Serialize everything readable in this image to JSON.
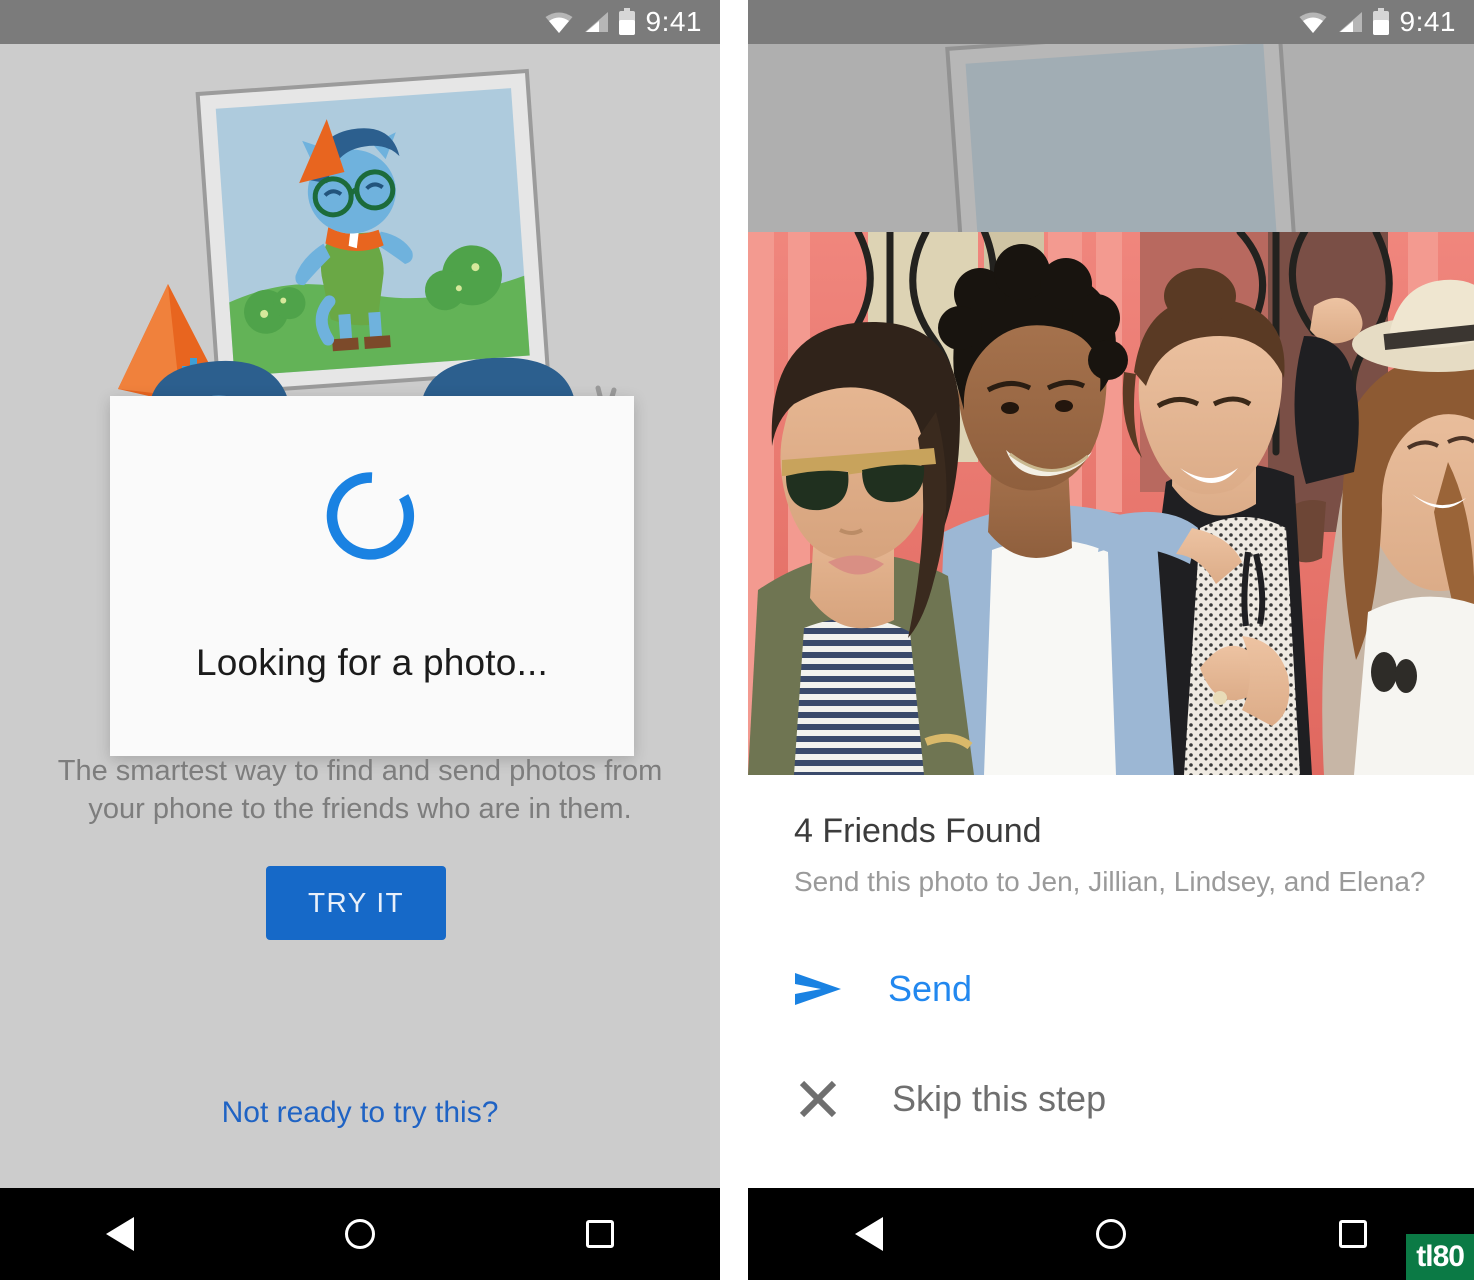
{
  "colors": {
    "accent_blue": "#1669c8",
    "link_blue": "#1f63c4",
    "send_blue": "#2288ef",
    "spinner_blue": "#1a82e2",
    "panel_bg": "#cccccc",
    "statusbar_bg": "#7b7b7b",
    "navbar_bg": "#000000",
    "dialog_bg": "#fafafa",
    "muted_text": "#7d7d7d",
    "watermark_green": "#0b7a45"
  },
  "statusbar": {
    "time": "9:41",
    "icons": [
      "wifi-icon",
      "cellular-signal-icon",
      "battery-icon"
    ]
  },
  "navbar": {
    "back_label": "Back",
    "home_label": "Home",
    "recents_label": "Recent apps",
    "icons": [
      "nav-back-icon",
      "nav-home-icon",
      "nav-recents-icon"
    ]
  },
  "left_screen": {
    "illustration_name": "photo-frame-characters-illustration",
    "dialog": {
      "spinner_name": "loading-spinner",
      "message": "Looking for a photo..."
    },
    "tagline_line1": "The smartest way to find and send photos from",
    "tagline_line2": "your phone to the friends who are in them.",
    "cta_label": "TRY IT",
    "secondary_link": "Not ready to try this?"
  },
  "right_screen": {
    "photo_name": "four-friends-group-photo",
    "photo_alt": "Four smiling women posing in front of a pink building with iron gates",
    "title": "4 Friends Found",
    "subtitle": "Send this photo to Jen, Jillian, Lindsey, and Elena?",
    "actions": [
      {
        "label": "Send",
        "icon": "send-arrow-icon"
      },
      {
        "label": "Skip this step",
        "icon": "close-x-icon"
      }
    ]
  },
  "watermark": {
    "text": "tl80"
  }
}
